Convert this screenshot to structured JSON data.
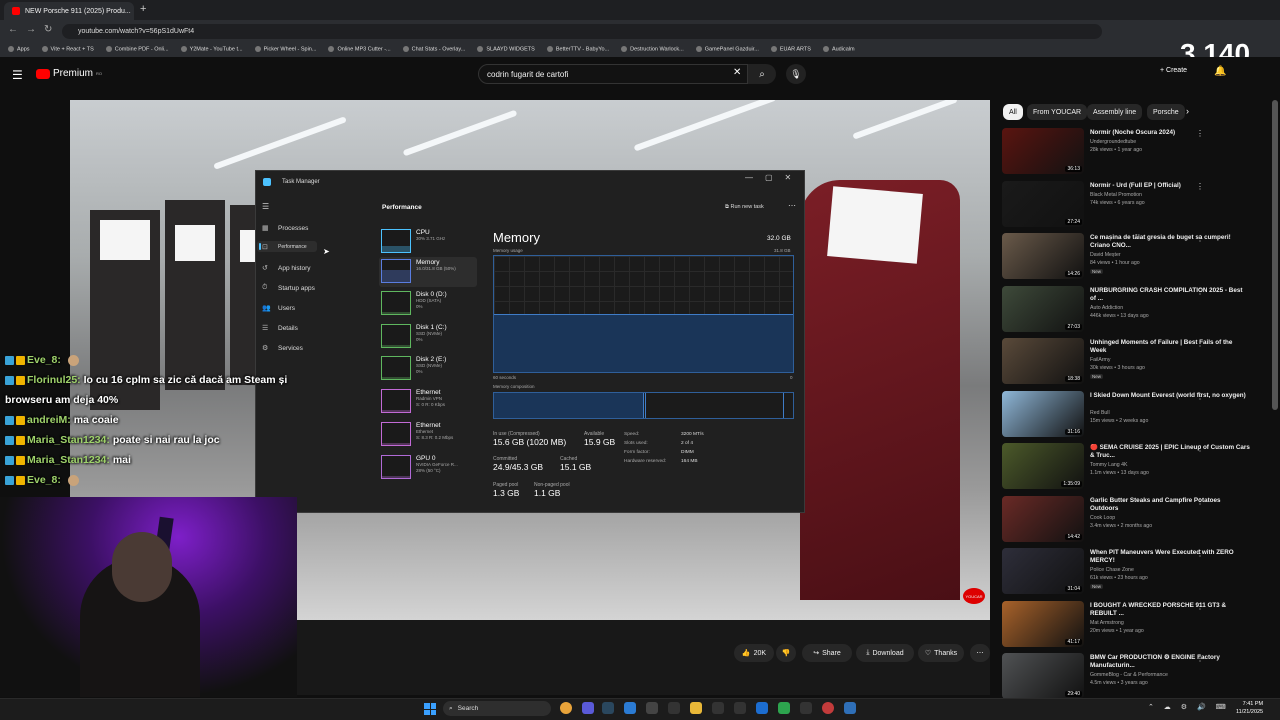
{
  "browser": {
    "tab_title": "NEW Porsche 911 (2025) Produ...",
    "new_tab": "+",
    "url": "youtube.com/watch?v=56pS1dUwFt4",
    "bookmarks": [
      "Apps",
      "Vite + React + TS",
      "Combine PDF - Onli...",
      "Y2Mate - YouTube t...",
      "Picker Wheel - Spin...",
      "Online MP3 Cutter -...",
      "Chat Stats - Overlay...",
      "SLAAYD WIDGETS",
      "BetterTTV - BabyYo...",
      "Destruction Warlock...",
      "GamePanel Gazduir...",
      "EUAR ARTS",
      "Audicalm"
    ]
  },
  "overlay": {
    "viewer_count": "3,140"
  },
  "youtube": {
    "logo": "Premium",
    "logo_sup": "RO",
    "search_value": "codrin fugarit de cartofi",
    "create_label": "+ Create",
    "actions": {
      "like": "20K",
      "share": "Share",
      "download": "Download",
      "thanks": "Thanks"
    },
    "watermark": "YOUCAR"
  },
  "chips": [
    "All",
    "From YOUCAR",
    "Assembly line",
    "Porsche"
  ],
  "recommendations": [
    {
      "title": "Normir (Noche Oscura 2024)",
      "channel": "Undergroundedtube",
      "meta": "28k views • 1 year ago",
      "duration": "36:13",
      "new": "",
      "color": "#5a1410"
    },
    {
      "title": "Normir - Urd (Full EP | Official)",
      "channel": "Black Metal Promotion",
      "meta": "74k views • 6 years ago",
      "duration": "27:24",
      "new": "",
      "color": "#1a1a1a"
    },
    {
      "title": "Ce mașina de tăiat gresia de buget sa cumperi! Criano CNO...",
      "channel": "David Meșter",
      "meta": "84 views • 1 hour ago",
      "duration": "14:26",
      "new": "New",
      "color": "#6a5a4a"
    },
    {
      "title": "NÜRBURGRING CRASH COMPILATION 2025 - Best of ...",
      "channel": "Auto Addiction",
      "meta": "446k views • 13 days ago",
      "duration": "27:03",
      "new": "",
      "color": "#3e4a3a"
    },
    {
      "title": "Unhinged Moments of Failure | Best Fails of the Week",
      "channel": "FailArmy",
      "meta": "30k views • 3 hours ago",
      "duration": "18:38",
      "new": "New",
      "color": "#5a4a3a"
    },
    {
      "title": "I Skied Down Mount Everest (world first, no oxygen)",
      "channel": "Red Bull",
      "meta": "15m views • 2 weeks ago",
      "duration": "31:16",
      "new": "",
      "color": "#8fb7d8"
    },
    {
      "title": "🔴 SEMA CRUISE 2025 | EPIC Lineup of Custom Cars & Truc...",
      "channel": "Tommy Lang 4K",
      "meta": "1.1m views • 13 days ago",
      "duration": "1:35:09",
      "new": "",
      "color": "#4c5a2a"
    },
    {
      "title": "Garlic Butter Steaks and Campfire Potatoes Outdoors",
      "channel": "Cook Loop",
      "meta": "3.4m views • 2 months ago",
      "duration": "14:42",
      "new": "",
      "color": "#6a2a26"
    },
    {
      "title": "When PIT Maneuvers Were Executed with ZERO MERCY!",
      "channel": "Police Chase Zone",
      "meta": "61k views • 23 hours ago",
      "duration": "31:04",
      "new": "New",
      "color": "#2e2e3a"
    },
    {
      "title": "I BOUGHT A WRECKED PORSCHE 911 GT3 & REBUILT ...",
      "channel": "Mat Armstrong",
      "meta": "20m views • 1 year ago",
      "duration": "41:17",
      "new": "",
      "color": "#a8622a"
    },
    {
      "title": "BMW Car PRODUCTION ⚙ ENGINE Factory Manufacturin...",
      "channel": "GommeBlog - Car & Performance",
      "meta": "4.5m views • 3 years ago",
      "duration": "29:40",
      "new": "",
      "color": "#505254"
    }
  ],
  "task_manager": {
    "title": "Task Manager",
    "nav": [
      "Processes",
      "Performance",
      "App history",
      "Startup apps",
      "Users",
      "Details",
      "Services"
    ],
    "header": "Performance",
    "run_new_task": "Run new task",
    "resources": [
      {
        "name": "CPU",
        "detail1": "30% 3.71 GHz",
        "detail2": "",
        "detail3": ""
      },
      {
        "name": "Memory",
        "detail1": "16.0/31.8 GB (50%)",
        "detail2": "",
        "detail3": ""
      },
      {
        "name": "Disk 0 (D:)",
        "detail1": "HDD (SATA)",
        "detail2": "0%",
        "detail3": ""
      },
      {
        "name": "Disk 1 (C:)",
        "detail1": "SSD (NVMe)",
        "detail2": "0%",
        "detail3": ""
      },
      {
        "name": "Disk 2 (E:)",
        "detail1": "SSD (NVMe)",
        "detail2": "0%",
        "detail3": ""
      },
      {
        "name": "Ethernet",
        "detail1": "Radmin VPN",
        "detail2": "S: 0 R: 0 Kbps",
        "detail3": ""
      },
      {
        "name": "Ethernet",
        "detail1": "Ethernet",
        "detail2": "S: 8.3 R: 0.2 Mbps",
        "detail3": ""
      },
      {
        "name": "GPU 0",
        "detail1": "NVIDIA GeForce R...",
        "detail2": "28% (50 °C)",
        "detail3": ""
      }
    ],
    "memory": {
      "title": "Memory",
      "total": "32.0 GB",
      "usage_label": "Memory usage",
      "usage_max": "31.8 GB",
      "seconds_label": "60 seconds",
      "zero": "0",
      "composition_label": "Memory composition",
      "usage_fraction": 0.5,
      "in_use_label": "In use (Compressed)",
      "in_use": "15.6 GB (1020 MB)",
      "available_label": "Available",
      "available": "15.9 GB",
      "committed_label": "Committed",
      "committed": "24.9/45.3 GB",
      "cached_label": "Cached",
      "cached": "15.1 GB",
      "paged_label": "Paged pool",
      "paged": "1.3 GB",
      "nonpaged_label": "Non-paged pool",
      "nonpaged": "1.1 GB",
      "speed_label": "Speed:",
      "speed": "3200 MT/s",
      "slots_label": "Slots used:",
      "slots": "2 of 4",
      "form_label": "Form factor:",
      "form": "DIMM",
      "hwres_label": "Hardware reserved:",
      "hwres": "164 MB"
    }
  },
  "chat": [
    {
      "user": "Eve_8:",
      "text": "",
      "emote": true
    },
    {
      "user": "Florinul25:",
      "text": "Io cu 16 cplm sa zic că dacă am Steam și",
      "emote": false
    },
    {
      "user": "",
      "text": "browseru am deja 40%",
      "emote": false
    },
    {
      "user": "andreiM:",
      "text": "ma coaie",
      "emote": false
    },
    {
      "user": "Maria_Stan1234:",
      "text": "poate si nai rau la joc",
      "emote": false
    },
    {
      "user": "Maria_Stan1234:",
      "text": "mai",
      "emote": false
    },
    {
      "user": "Eve_8:",
      "text": "",
      "emote": true
    }
  ],
  "taskbar": {
    "search": "Search",
    "time": "7:41 PM",
    "date": "11/21/2025"
  }
}
